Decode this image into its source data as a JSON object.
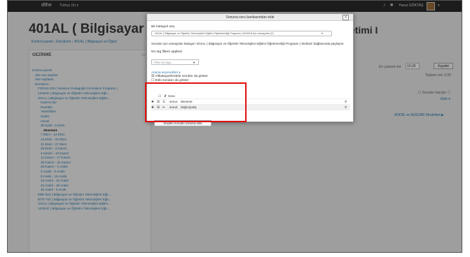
{
  "topbar": {
    "brand": "dthe",
    "language": "Türkçe (tr) ▾",
    "user_name": "Yavuz GÖKTAŞ",
    "caret": "▾"
  },
  "page": {
    "course_title": "401AL ( Bilgisayar ve Öğr",
    "course_title_right": "eliştirme Ve Yönetimi I",
    "breadcrumb": "Kontrol paneli › Derslerim › 401AL ( Bilgisayar ve Öğret",
    "nav_heading": "GEZİNME",
    "nav_items": [
      {
        "label": "Kontrol paneli",
        "level": 0
      },
      {
        "label": "Site ana sayfası",
        "level": 1
      },
      {
        "label": "Site sayfaları",
        "level": 1
      },
      {
        "label": "Derslerim",
        "level": 1
      },
      {
        "label": "FOR16-108 ( Advance Pedagojik Formasyon Programı )",
        "level": 2
      },
      {
        "label": "1203AE ( Bilgisayar ve Öğretim Teknolojileri Eğit...",
        "level": 2
      },
      {
        "label": "401AL ( Bilgisayar ve Öğretim Teknolojileri Eğitim...",
        "level": 2
      },
      {
        "label": "Katılımcılar",
        "level": 3
      },
      {
        "label": "Rozetler",
        "level": 3
      },
      {
        "label": "Yeterlilikler",
        "level": 3
      },
      {
        "label": "Notlar",
        "level": 3
      },
      {
        "label": "Genel",
        "level": 3
      },
      {
        "label": "30 Eylül - 6 Ekim",
        "level": 3
      },
      {
        "label": "deneme1",
        "level": 4,
        "bold": true
      },
      {
        "label": "7 Ekim - 13 Ekim",
        "level": 3
      },
      {
        "label": "14 Ekim - 20 Ekim",
        "level": 3
      },
      {
        "label": "21 Ekim - 27 Ekim",
        "level": 3
      },
      {
        "label": "28 Ekim - 3 Kasım",
        "level": 3
      },
      {
        "label": "4 Kasım - 10 Kasım",
        "level": 3
      },
      {
        "label": "11 Kasım - 17 Kasım",
        "level": 3
      },
      {
        "label": "18 Kasım - 24 Kasım",
        "level": 3
      },
      {
        "label": "25 Kasım - 1 Aralık",
        "level": 3
      },
      {
        "label": "2 Aralık - 8 Aralık",
        "level": 3
      },
      {
        "label": "9 Aralık - 15 Aralık",
        "level": 3
      },
      {
        "label": "16 Aralık - 22 Aralık",
        "level": 3
      },
      {
        "label": "23 Aralık - 29 Aralık",
        "level": 3
      },
      {
        "label": "30 Aralık - 5 Ocak",
        "level": 3
      },
      {
        "label": "EBE-510 ( Bilgisayar ve Öğretim Teknolojileri Eğit...",
        "level": 2
      },
      {
        "label": "BTO-703 ( Bilgisayar ve Öğretim Teknolojileri Eğit...",
        "level": 2
      },
      {
        "label": "101AL ( Bilgisayar ve Öğretim Teknolojileri Eğitim...",
        "level": 2
      },
      {
        "label": "1203AE ( Bilgisayar ve Öğretim Teknolojileri Eğit...",
        "level": 2
      }
    ],
    "max_grade_label": "En yüksek not",
    "max_grade_value": "10,00",
    "save_label": "Kaydet",
    "total_label": "Toplam not: 0,00",
    "shuffle_label": "Soruları karıştır",
    "add_label": "Ekle ▾",
    "adx_label": "ADDIE ve ASSURE Modelleri ▶"
  },
  "modal": {
    "title": "Sonuna soru bankasından ekle",
    "close": "X",
    "select_category_label": "Bir kategori seç:",
    "category_value": "401AL ( Bilgisayar ve Öğretim Teknolojileri Eğitimi Öğretmenliği Programı ) 604618 için varsayılan (2)",
    "category_info": "Soruları için varsayılan kategori '401AL ( Bilgisayar ve Öğretim Teknolojileri Eğitimi Öğretmenliği Programı ) 604618' bağlamında paylaşılır.",
    "no_tag_filters": "No tag filters applied",
    "filter_placeholder": "Filter by tags...",
    "search_options": "Arama seçenekleri ▾",
    "show_subcategory": "Altkategorilerdeki soruları da göster",
    "show_old": "Eski soruları da göster",
    "table_header": "Soru",
    "questions": [
      {
        "name": "soru1",
        "text": "deneme"
      },
      {
        "name": "soru2",
        "text": "doğru/yalış"
      }
    ],
    "add_button": "Seçilen soruları sonuna ekle"
  }
}
